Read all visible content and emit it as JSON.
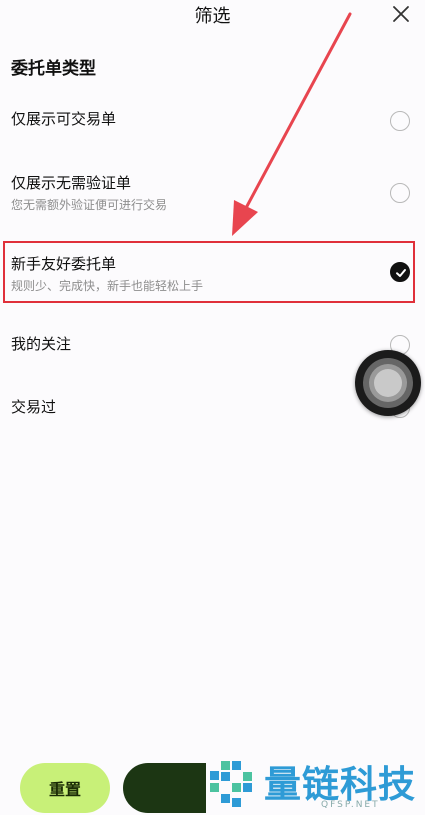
{
  "header": {
    "title": "筛选"
  },
  "section": {
    "title": "委托单类型"
  },
  "options": [
    {
      "label": "仅展示可交易单",
      "sub": "",
      "checked": false
    },
    {
      "label": "仅展示无需验证单",
      "sub": "您无需额外验证便可进行交易",
      "checked": false
    },
    {
      "label": "新手友好委托单",
      "sub": "规则少、完成快，新手也能轻松上手",
      "checked": true
    },
    {
      "label": "我的关注",
      "sub": "",
      "checked": false
    },
    {
      "label": "交易过",
      "sub": "",
      "checked": false
    }
  ],
  "footer": {
    "reset_label": "重置",
    "confirm_label": ""
  },
  "watermark": {
    "text": "量链科技",
    "url": "QFSP.NET"
  },
  "colors": {
    "accent": "#c8f078",
    "dark_button": "#1c3613",
    "highlight": "#e0303a",
    "watermark": "#2e9bd6"
  },
  "icons": {
    "close": "close-icon",
    "check": "check-icon",
    "arrow": "annotation-arrow"
  }
}
